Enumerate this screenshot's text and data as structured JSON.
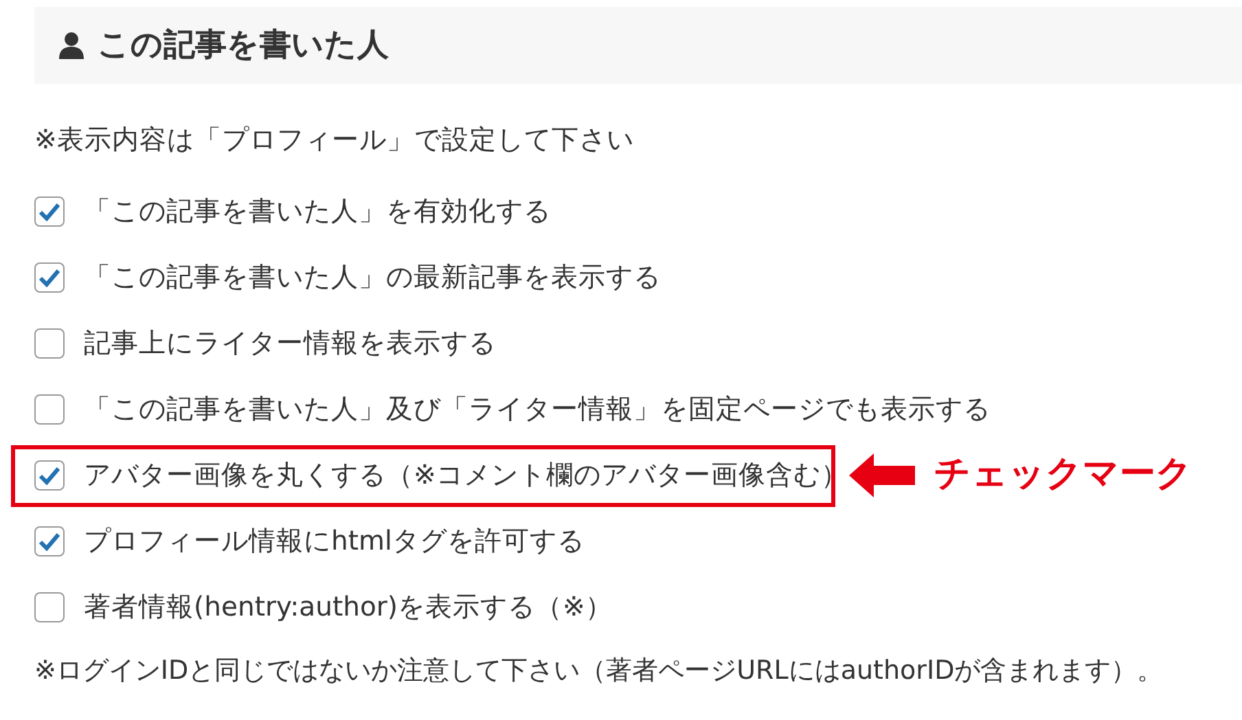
{
  "section": {
    "title": "この記事を書いた人"
  },
  "note": "※表示内容は「プロフィール」で設定して下さい",
  "options": [
    {
      "label": "「この記事を書いた人」を有効化する",
      "checked": true,
      "highlighted": false
    },
    {
      "label": "「この記事を書いた人」の最新記事を表示する",
      "checked": true,
      "highlighted": false
    },
    {
      "label": "記事上にライター情報を表示する",
      "checked": false,
      "highlighted": false
    },
    {
      "label": "「この記事を書いた人」及び「ライター情報」を固定ページでも表示する",
      "checked": false,
      "highlighted": false
    },
    {
      "label": "アバター画像を丸くする（※コメント欄のアバター画像含む）",
      "checked": true,
      "highlighted": true
    },
    {
      "label": "プロフィール情報にhtmlタグを許可する",
      "checked": true,
      "highlighted": false
    },
    {
      "label": "著者情報(hentry:author)を表示する（※）",
      "checked": false,
      "highlighted": false
    }
  ],
  "footer_note": "※ログインIDと同じではないか注意して下さい（著者ページURLにはauthorIDが含まれます）。",
  "annotation": {
    "label": "チェックマーク"
  }
}
